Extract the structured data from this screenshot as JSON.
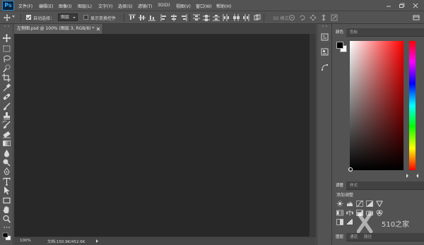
{
  "app": {
    "logo": "Ps"
  },
  "menu": [
    "文件(F)",
    "编辑(E)",
    "图像(I)",
    "图层(L)",
    "文字(Y)",
    "选择(S)",
    "滤镜(T)",
    "3D(D)",
    "视图(V)",
    "窗口(W)",
    "帮助(H)"
  ],
  "options": {
    "auto_select_label": "自动选择：",
    "auto_select_checked": true,
    "auto_select_value": "图层",
    "transform_label": "显示变换控件",
    "transform_checked": false,
    "mode_3d_label": "3D 模式："
  },
  "document": {
    "tab_title": "左侧图.psd @ 100% (图层 3, RGB/8) *",
    "zoom": "100%",
    "doc_info": "文档:150.9K/452.6K",
    "canvas_color": "#282828"
  },
  "color_panel": {
    "tabs": [
      "颜色",
      "色板"
    ],
    "active_tab": 0,
    "foreground": "#000000",
    "background": "#ffffff",
    "hue": "#ff0000"
  },
  "adjustments_panel": {
    "tabs": [
      "调整",
      "样式"
    ],
    "active_tab": 0,
    "title": "添加调整"
  },
  "bottom_panel": {
    "tabs": [
      "图层",
      "通道",
      "路径"
    ],
    "active_tab": 0
  },
  "watermark": {
    "text": "510之家"
  }
}
